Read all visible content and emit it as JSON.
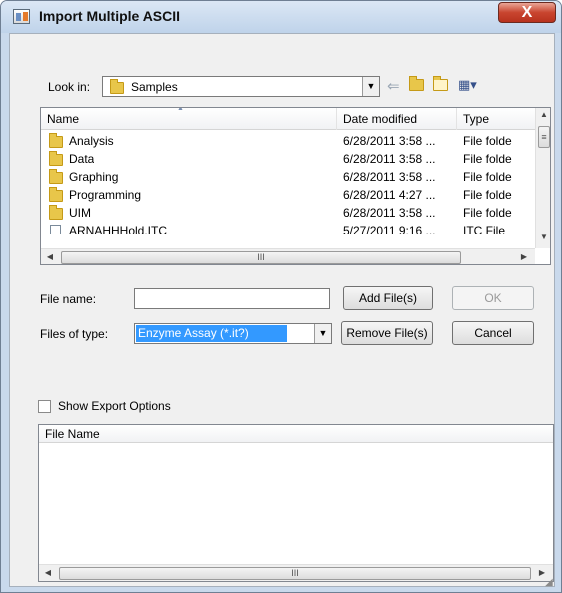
{
  "window": {
    "title": "Import Multiple ASCII",
    "close_glyph": "X"
  },
  "look_in": {
    "label": "Look in:",
    "value": "Samples"
  },
  "file_list": {
    "columns": [
      "Name",
      "Date modified",
      "Type"
    ],
    "rows": [
      {
        "icon": "folder-icon",
        "name": "Analysis",
        "date": "6/28/2011 3:58 ...",
        "type": "File folde"
      },
      {
        "icon": "folder-icon",
        "name": "Data",
        "date": "6/28/2011 3:58 ...",
        "type": "File folde"
      },
      {
        "icon": "folder-icon",
        "name": "Graphing",
        "date": "6/28/2011 3:58 ...",
        "type": "File folde"
      },
      {
        "icon": "folder-icon",
        "name": "Programming",
        "date": "6/28/2011 4:27 ...",
        "type": "File folde"
      },
      {
        "icon": "folder-icon",
        "name": "UIM",
        "date": "6/28/2011 3:58 ...",
        "type": "File folde"
      },
      {
        "icon": "file-icon",
        "name": "ARNAHHHold.ITC",
        "date": "5/27/2011 9:16 ...",
        "type": "ITC File"
      }
    ]
  },
  "file_name": {
    "label": "File name:",
    "value": ""
  },
  "files_of_type": {
    "label": "Files of type:",
    "value": "Enzyme Assay (*.it?)"
  },
  "buttons": {
    "add": "Add File(s)",
    "ok": "OK",
    "remove": "Remove File(s)",
    "cancel": "Cancel"
  },
  "export": {
    "label": "Show Export Options",
    "checked": false
  },
  "selected_list": {
    "column": "File Name"
  },
  "scroll_grip": "III",
  "colors": {
    "selection": "#3399ff",
    "titlebar": "#c9d9ec",
    "close": "#c9452f"
  }
}
